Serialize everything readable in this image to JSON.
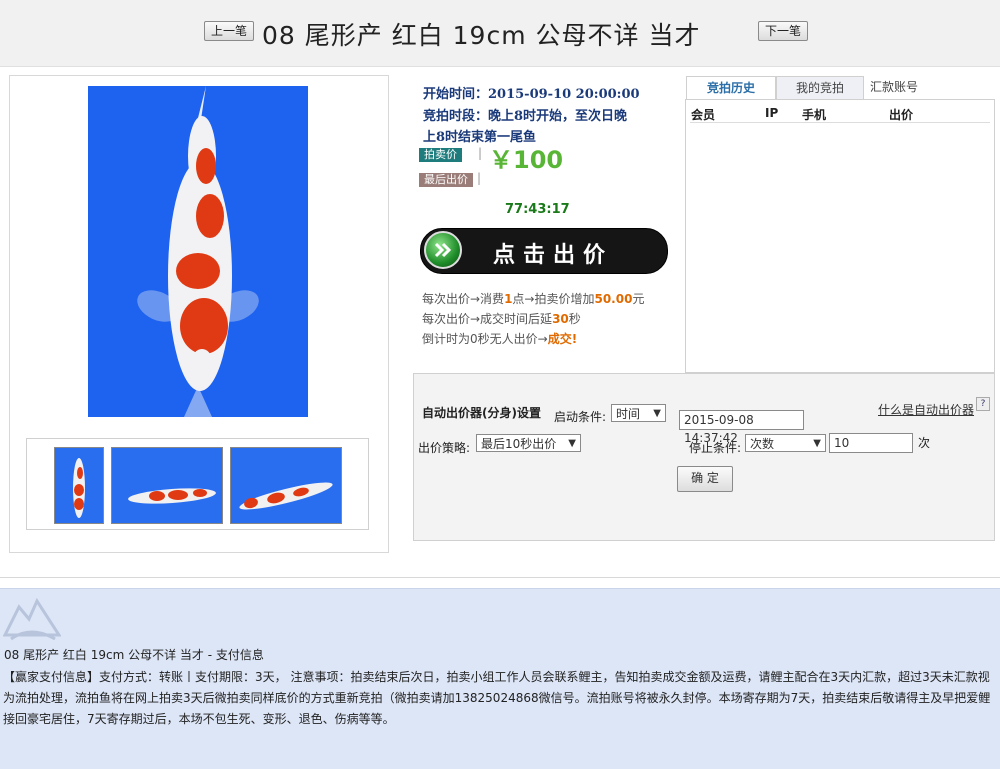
{
  "header": {
    "prev_label": "上一笔",
    "next_label": "下一笔",
    "title": "08 尾形产 红白 19cm 公母不详 当才"
  },
  "auction": {
    "start_time": "开始时间：2015-09-10 20:00:00",
    "period_line1": "竞拍时段：晚上8时开始，至次日晚",
    "period_line2": "上8时结束第一尾鱼",
    "price_tag": "拍卖价",
    "last_bidder_tag": "最后出价",
    "sep": "|",
    "price": "￥100",
    "countdown": "77:43:17",
    "bid_button_label": "点击出价",
    "rules": {
      "r1_a": "每次出价→消费",
      "r1_b": "1",
      "r1_c": "点→拍卖价增加",
      "r1_d": "50.00",
      "r1_e": "元",
      "r2_a": "每次出价→成交时间后延",
      "r2_b": "30",
      "r2_c": "秒",
      "r3_a": "倒计时为0秒无人出价→",
      "r3_b": "成交!"
    }
  },
  "history": {
    "tabs": [
      "竞拍历史",
      "我的竞拍",
      "汇款账号"
    ],
    "columns": [
      "会员",
      "IP",
      "手机",
      "出价"
    ]
  },
  "autobid": {
    "title": "自动出价器(分身)设置",
    "start_cond_label": "启动条件:",
    "start_cond_value": "时间",
    "start_time_value": "2015-09-08 14:37:42",
    "whatis": "什么是自动出价器",
    "help": "?",
    "strategy_label": "出价策略:",
    "strategy_value": "最后10秒出价",
    "stop_cond_label": "停止条件:",
    "stop_cond_value": "次数",
    "stop_count": "10",
    "stop_unit": "次",
    "confirm_label": "确 定"
  },
  "bottom": {
    "title": "08 尾形产 红白 19cm 公母不详 当才   -   支付信息",
    "pay_info": "【赢家支付信息】支付方式：转账丨支付期限：3天， 注意事项：拍卖结束后次日，拍卖小组工作人员会联系鲤主，告知拍卖成交金额及运费，请鲤主配合在3天内汇款，超过3天未汇款视为流拍处理，流拍鱼将在网上拍卖3天后微拍卖同样底价的方式重新竞拍（微拍卖请加13825024868微信号。流拍账号将被永久封停。本场寄存期为7天，拍卖结束后敬请得主及早把爱鲤接回豪宅居住，7天寄存期过后，本场不包生死、变形、退色、伤病等等。"
  },
  "colors": {
    "price_green": "#58b535",
    "countdown_green": "#1a7a1a",
    "highlight_orange": "#e06a00",
    "photo_blue": "#1e62f0",
    "bottom_bg": "#dde6f7"
  }
}
